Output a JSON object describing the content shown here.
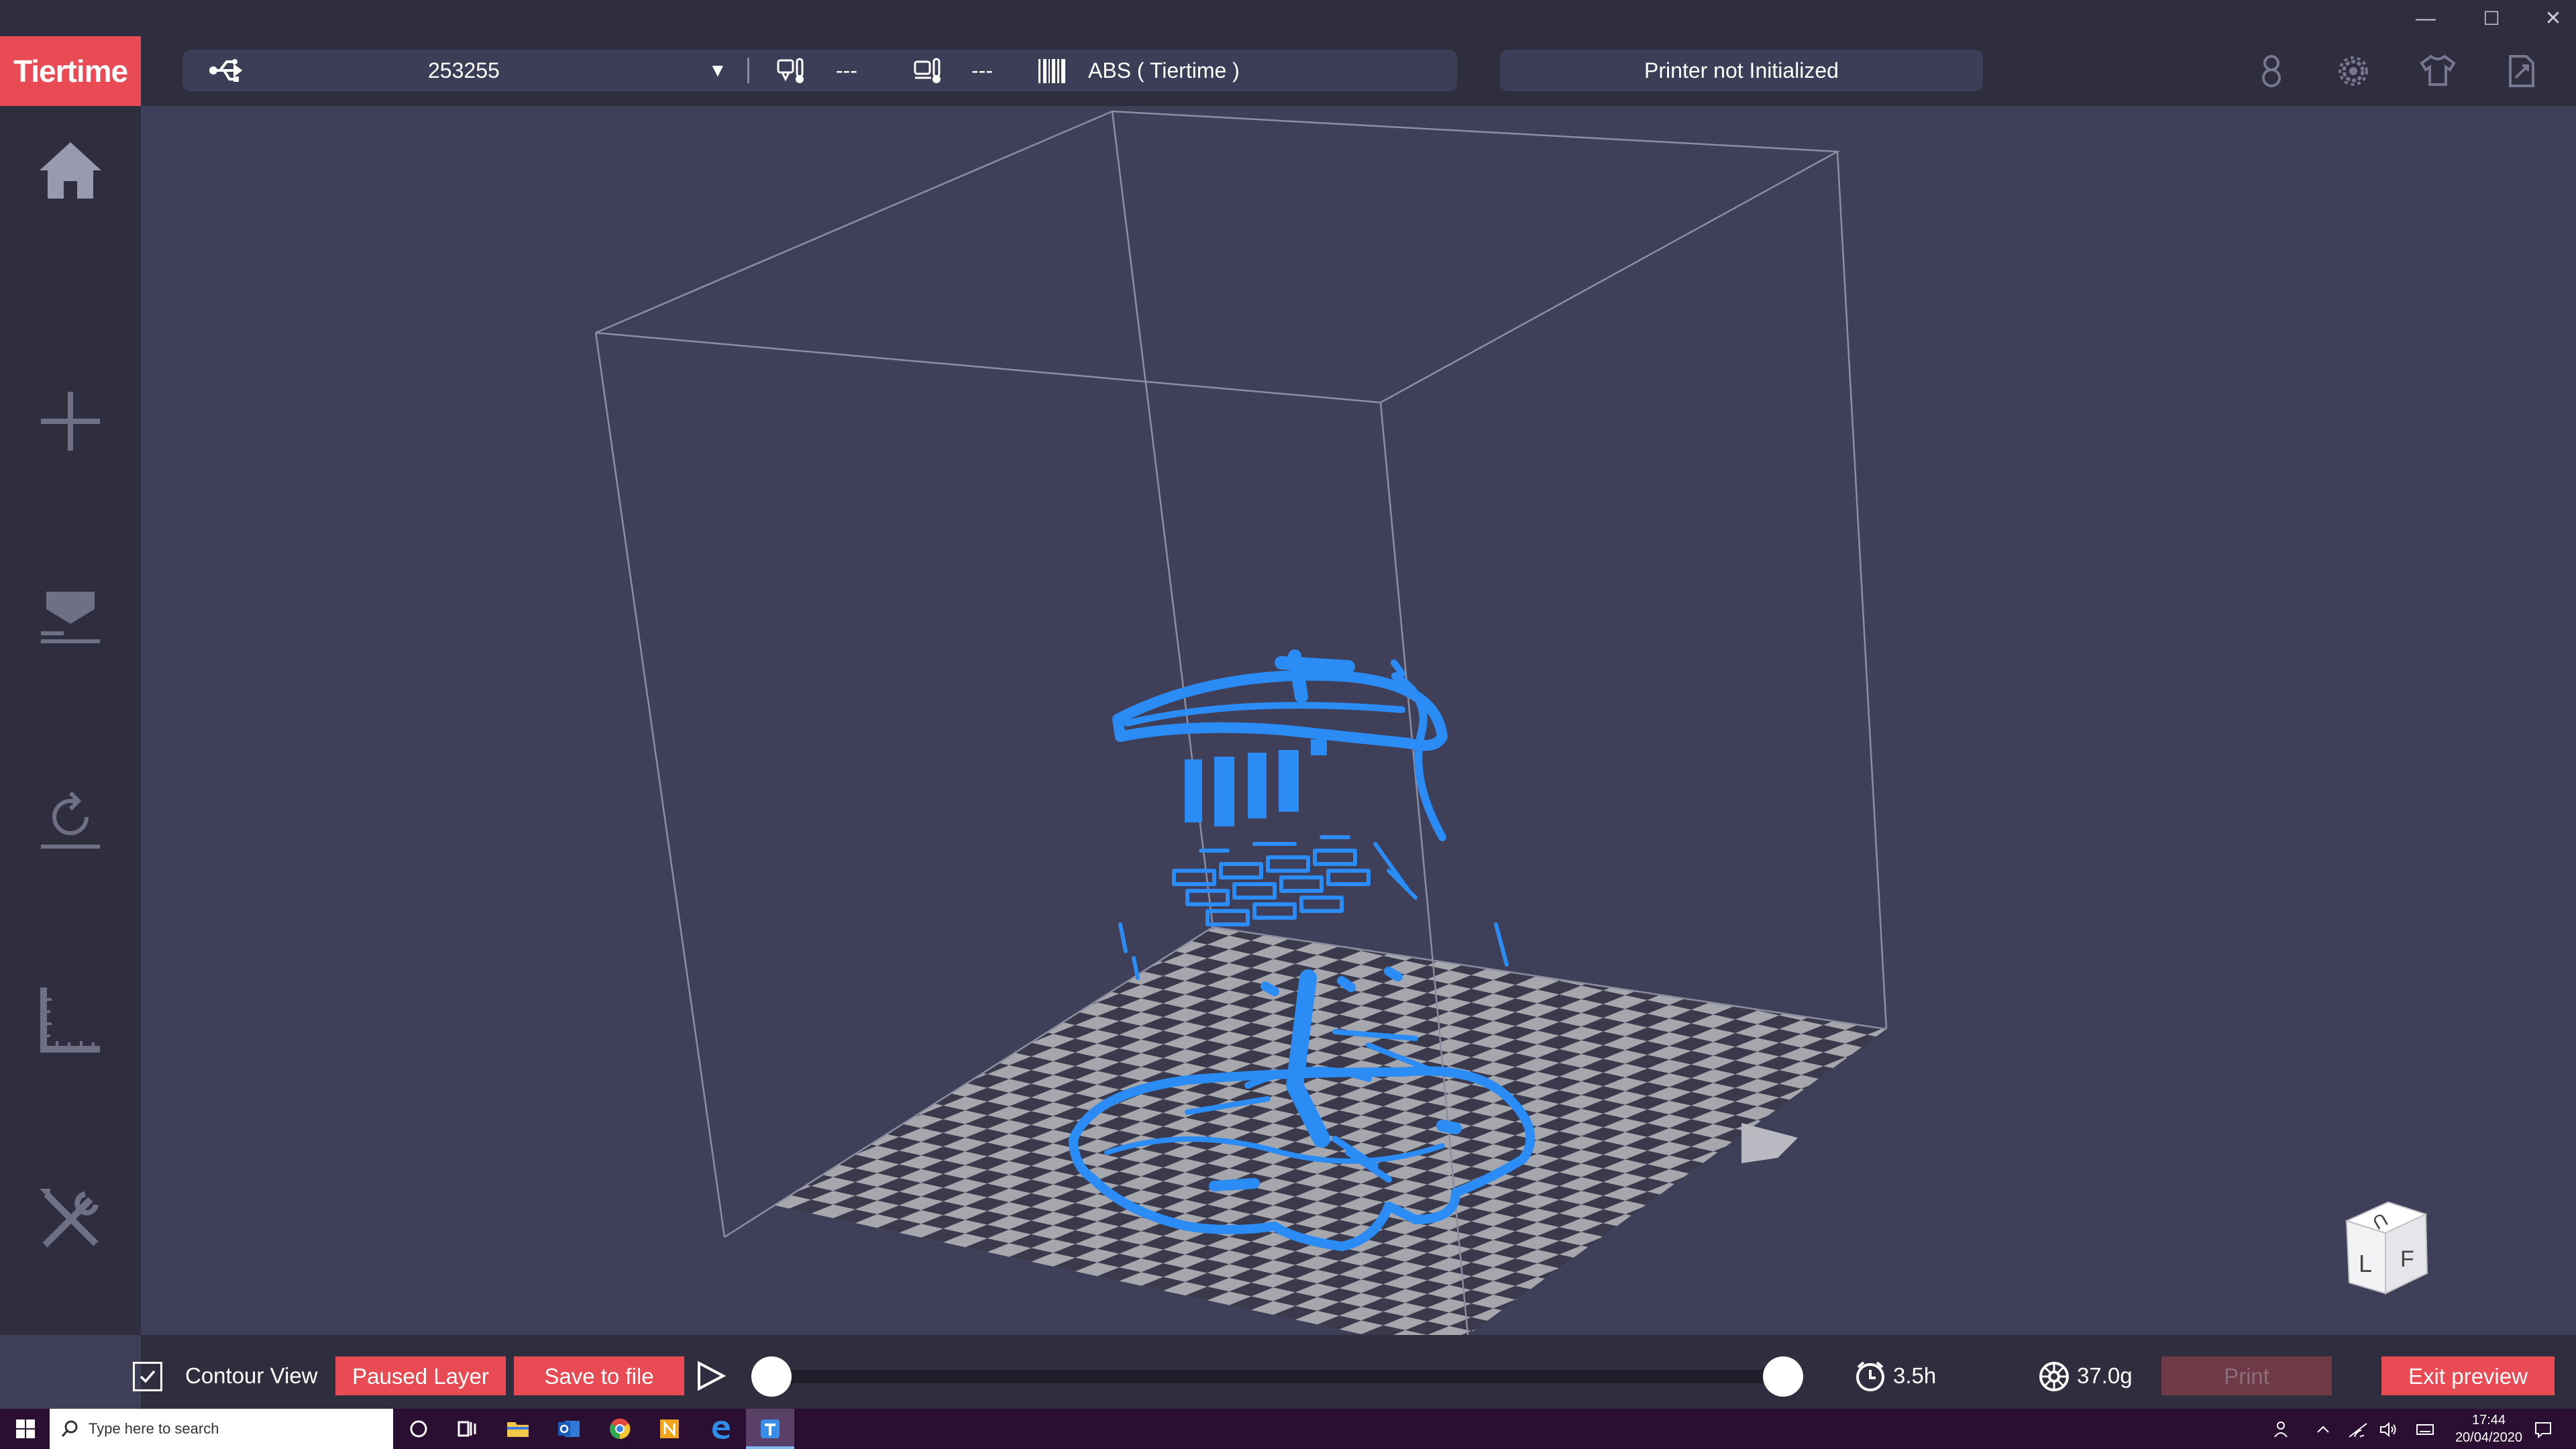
{
  "app": {
    "logo_text": "Tiertime"
  },
  "window_controls": {
    "minimize": "—",
    "maximize": "☐",
    "close": "✕"
  },
  "toolbar": {
    "connection_icon": "usb-icon",
    "printer_id": "253255",
    "printer_dropdown_glyph": "▼",
    "nozzle_temp": "---",
    "bed_temp": "---",
    "material": "ABS ( Tiertime )",
    "status": "Printer not Initialized",
    "right_icons": [
      "print-count-icon",
      "settings-gear-icon",
      "shirt-skin-icon",
      "export-icon"
    ]
  },
  "sidebar": {
    "items": [
      {
        "name": "home",
        "icon": "home-icon"
      },
      {
        "name": "add-model",
        "icon": "plus-icon"
      },
      {
        "name": "print",
        "icon": "print-tray-icon"
      },
      {
        "name": "rotate",
        "icon": "rotate-icon"
      },
      {
        "name": "measure",
        "icon": "ruler-icon"
      },
      {
        "name": "tools",
        "icon": "tools-icon"
      }
    ]
  },
  "viewport": {
    "model_color": "#2a8cf4",
    "view_cube_labels": {
      "top": "U",
      "left": "L",
      "front": "F"
    }
  },
  "bottom": {
    "contour_view_label": "Contour View",
    "contour_view_checked": true,
    "paused_layer_label": "Paused Layer",
    "save_to_file_label": "Save to file",
    "play_icon": "play-icon",
    "layer_range": {
      "start": 0,
      "end": 1
    },
    "time_estimate": "3.5h",
    "weight_estimate": "37.0g",
    "print_label": "Print",
    "exit_preview_label": "Exit preview"
  },
  "taskbar": {
    "search_placeholder": "Type here to search",
    "apps": [
      "start-icon",
      "cortana-icon",
      "task-view-icon",
      "file-explorer-icon",
      "outlook-icon",
      "chrome-icon",
      "onenote-icon",
      "edge-icon",
      "tiertime-icon"
    ],
    "time": "17:44",
    "date": "20/04/2020"
  },
  "colors": {
    "accent": "#e94b55",
    "bar_bg": "#2e2e3f",
    "viewport_bg": "#3f3f5a",
    "model": "#2a8cf4"
  }
}
